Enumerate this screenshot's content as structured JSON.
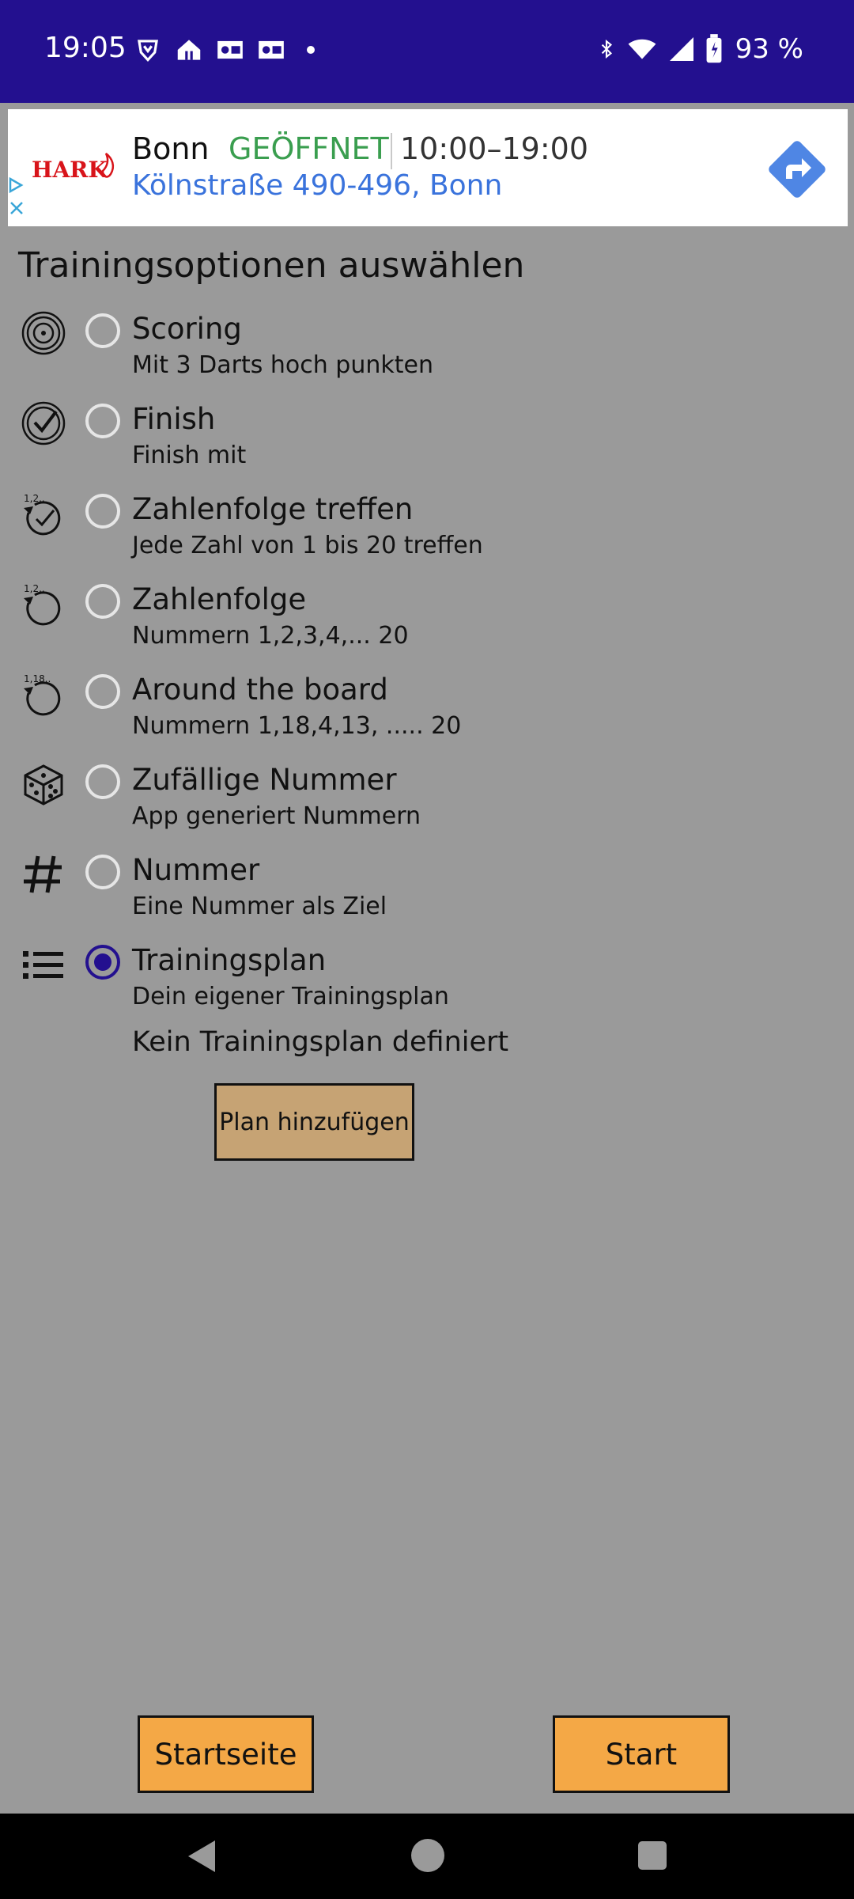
{
  "status_bar": {
    "time": "19:05",
    "battery": "93 %",
    "icons": [
      "brave-icon",
      "home-icon",
      "outlook-icon",
      "outlook-icon",
      "dot-icon",
      "bluetooth-icon",
      "wifi-icon",
      "signal-icon",
      "battery-icon"
    ]
  },
  "ad": {
    "brand": "HARK",
    "city": "Bonn",
    "status": "GEÖFFNET",
    "hours": "10:00–19:00",
    "address": "Kölnstraße 490-496, Bonn"
  },
  "screen": {
    "title": "Trainingsoptionen auswählen",
    "options": [
      {
        "title": "Scoring",
        "subtitle": "Mit 3 Darts hoch punkten",
        "icon": "target-icon",
        "checked": false
      },
      {
        "title": "Finish",
        "subtitle": "Finish mit",
        "icon": "target-check-icon",
        "checked": false
      },
      {
        "title": "Zahlenfolge treffen",
        "subtitle": "Jede Zahl von 1 bis 20 treffen",
        "icon": "sequence-check-icon",
        "checked": false
      },
      {
        "title": "Zahlenfolge",
        "subtitle": "Nummern 1,2,3,4,... 20",
        "icon": "sequence-circle-icon",
        "checked": false
      },
      {
        "title": "Around the board",
        "subtitle": "Nummern 1,18,4,13, ..... 20",
        "icon": "around-board-icon",
        "checked": false
      },
      {
        "title": "Zufällige Nummer",
        "subtitle": "App generiert Nummern",
        "icon": "dice-icon",
        "checked": false
      },
      {
        "title": "Nummer",
        "subtitle": "Eine Nummer als Ziel",
        "icon": "hash-icon",
        "checked": false
      },
      {
        "title": "Trainingsplan",
        "subtitle": "Dein eigener Trainingsplan",
        "icon": "list-icon",
        "checked": true
      }
    ],
    "no_plan_text": "Kein Trainingsplan definiert",
    "add_plan_button": "Plan hinzufügen",
    "home_button": "Startseite",
    "start_button": "Start"
  },
  "colors": {
    "status_bar": "#23108f",
    "background": "#9a9a9a",
    "accent": "#23108f",
    "add_plan_button": "#c6a374",
    "bottom_buttons": "#f4a846",
    "ad_open": "#3a9e4f",
    "ad_link": "#3a73dc"
  }
}
